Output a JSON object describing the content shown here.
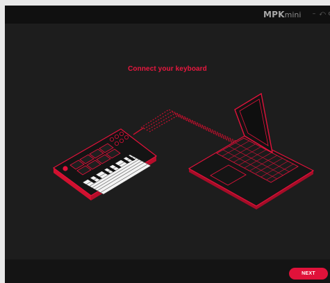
{
  "window": {
    "logo_bold": "MPK",
    "logo_light": "mini",
    "minimize_glyph": "–",
    "restore_glyph": "⤺",
    "close_glyph": "c"
  },
  "main": {
    "heading": "Connect your keyboard",
    "illustration": {
      "devices": [
        "keyboard-illustration",
        "laptop-illustration"
      ],
      "accent_color": "#e0123a"
    }
  },
  "footer": {
    "next_label": "NEXT"
  },
  "colors": {
    "accent": "#e0123a",
    "background": "#1d1d1d",
    "titlebar": "#101010",
    "footer": "#141414"
  }
}
